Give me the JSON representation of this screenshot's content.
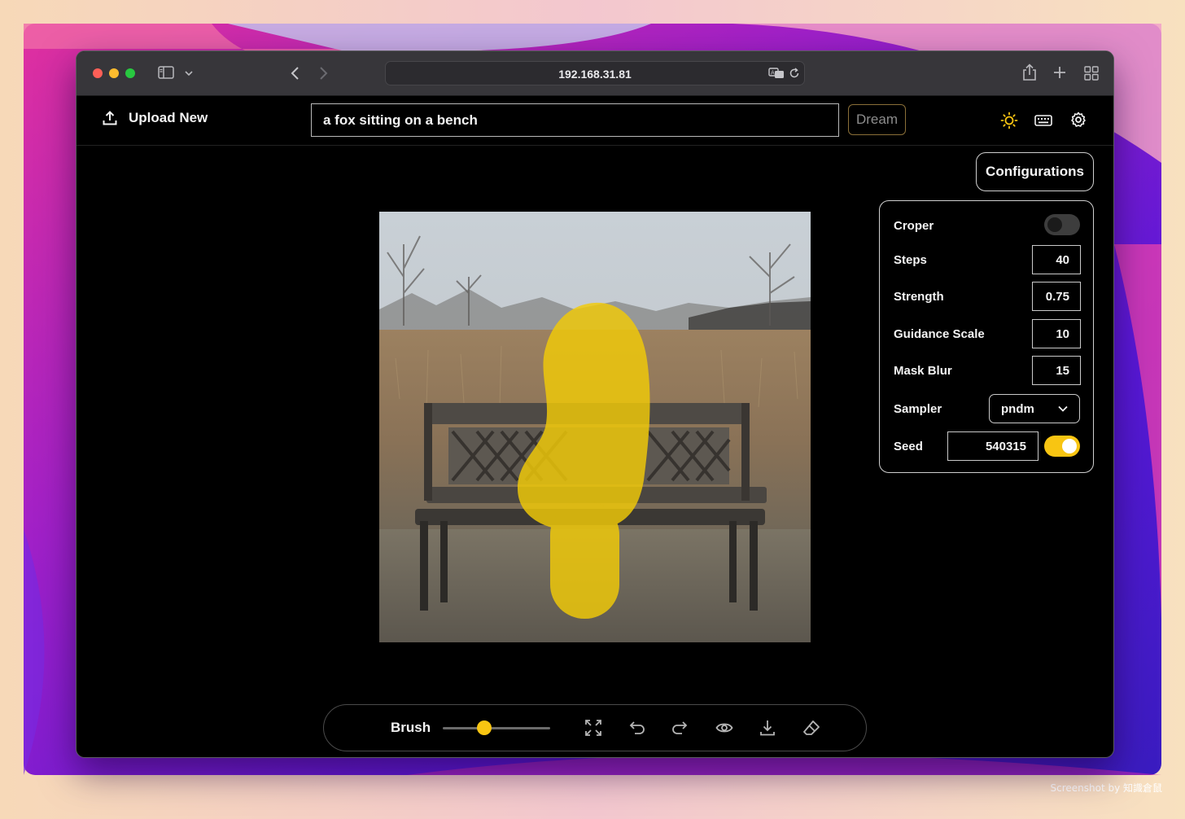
{
  "browser": {
    "url": "192.168.31.81"
  },
  "header": {
    "upload_label": "Upload New",
    "prompt_value": "a fox sitting on a bench",
    "dream_label": "Dream"
  },
  "configurations": {
    "button_label": "Configurations",
    "croper_label": "Croper",
    "croper_enabled": false,
    "steps_label": "Steps",
    "steps_value": "40",
    "strength_label": "Strength",
    "strength_value": "0.75",
    "guidance_label": "Guidance Scale",
    "guidance_value": "10",
    "mask_blur_label": "Mask Blur",
    "mask_blur_value": "15",
    "sampler_label": "Sampler",
    "sampler_value": "pndm",
    "seed_label": "Seed",
    "seed_value": "540315",
    "seed_fixed": true
  },
  "toolbar": {
    "brush_label": "Brush",
    "brush_size": 0.39
  },
  "icons": {
    "upload": "upload-icon",
    "theme": "sun-icon",
    "keyboard": "keyboard-icon",
    "settings": "gear-icon",
    "fullscreen": "fullscreen-icon",
    "undo": "undo-icon",
    "redo": "redo-icon",
    "preview": "eye-icon",
    "download": "download-icon",
    "eraser": "eraser-icon"
  },
  "colors": {
    "accent": "#f8c512",
    "mask": "#f2cb07",
    "panel_border": "#cfcfcf"
  },
  "watermark": "Screenshot by 知識倉鼠"
}
